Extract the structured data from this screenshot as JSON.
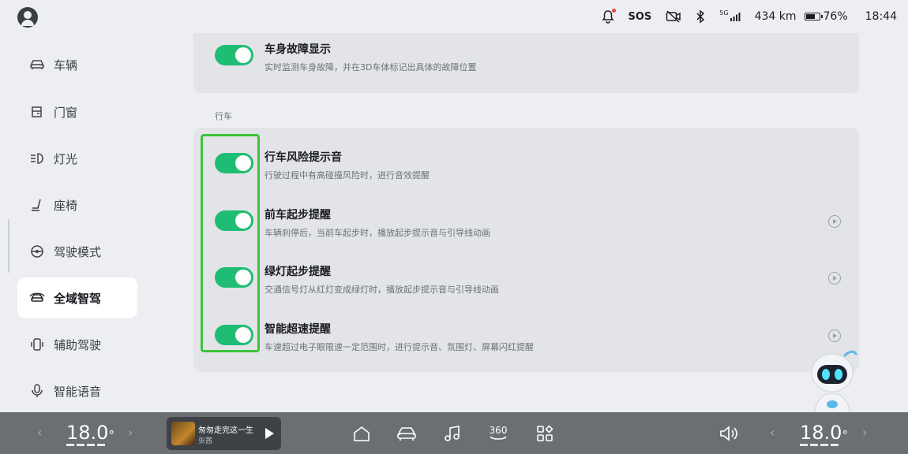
{
  "status_bar": {
    "sos_label": "SOS",
    "signal_label": "5G",
    "range": "434 km",
    "battery_percent": "76%",
    "battery_level": 0.76,
    "time": "18:44"
  },
  "sidebar": {
    "items": [
      {
        "label": "车辆",
        "icon": "car-icon",
        "active": false
      },
      {
        "label": "门窗",
        "icon": "door-icon",
        "active": false
      },
      {
        "label": "灯光",
        "icon": "headlight-icon",
        "active": false
      },
      {
        "label": "座椅",
        "icon": "seat-icon",
        "active": false
      },
      {
        "label": "驾驶模式",
        "icon": "steering-wheel-icon",
        "active": false
      },
      {
        "label": "全域智驾",
        "icon": "smart-drive-icon",
        "active": true
      },
      {
        "label": "辅助驾驶",
        "icon": "assist-drive-icon",
        "active": false
      },
      {
        "label": "智能语音",
        "icon": "microphone-icon",
        "active": false
      }
    ]
  },
  "top_setting": {
    "title": "车身故障显示",
    "description": "实时监测车身故障，并在3D车体标记出具体的故障位置",
    "enabled": true
  },
  "section": {
    "label": "行车",
    "settings": [
      {
        "title": "行车风险提示音",
        "description": "行驶过程中有高碰撞风险时，进行音效提醒",
        "enabled": true,
        "has_preview": false
      },
      {
        "title": "前车起步提醒",
        "description": "车辆刹停后，当前车起步时，播放起步提示音与引导线动画",
        "enabled": true,
        "has_preview": true
      },
      {
        "title": "绿灯起步提醒",
        "description": "交通信号灯从红灯变成绿灯时，播放起步提示音与引导线动画",
        "enabled": true,
        "has_preview": true
      },
      {
        "title": "智能超速提醒",
        "description": "车速超过电子眼限速一定范围时，进行提示音、氛围灯、屏幕闪红提醒",
        "enabled": true,
        "has_preview": true
      }
    ]
  },
  "dock": {
    "left_temp": "18.0",
    "left_temp_unit": "°",
    "right_temp": "18.0",
    "right_temp_unit": "°",
    "chevron_left": "‹",
    "chevron_right": "›",
    "media": {
      "title": "匆匆走完这一生",
      "artist": "张茜"
    },
    "camera_label": "360"
  },
  "colors": {
    "toggle_on": "#1fbd74",
    "highlight": "#3cc43a",
    "dock_bg": "#6b6e73"
  }
}
